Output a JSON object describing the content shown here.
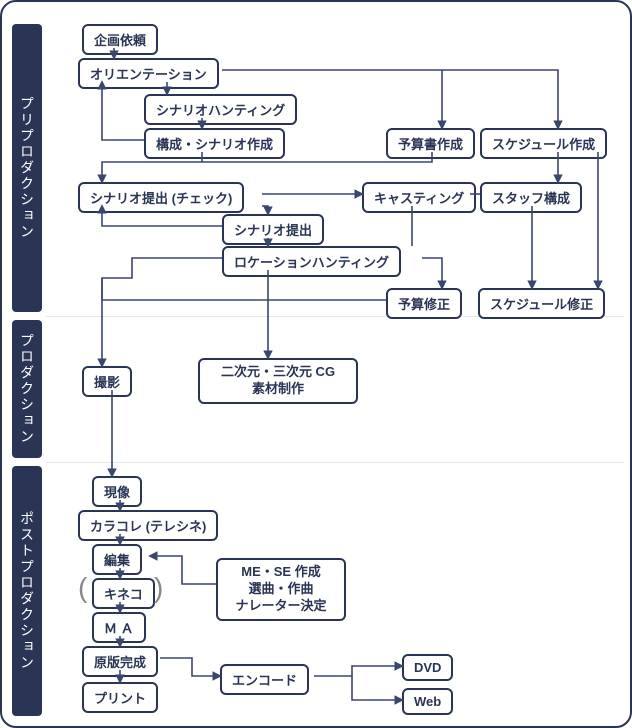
{
  "phases": {
    "pre": "プリプロダクション",
    "prod": "プロダクション",
    "post": "ポストプロダクション"
  },
  "nodes": {
    "n1": "企画依頼",
    "n2": "オリエンテーション",
    "n3": "シナリオハンティング",
    "n4": "構成・シナリオ作成",
    "n5": "予算書作成",
    "n6": "スケジュール作成",
    "n7": "シナリオ提出 (チェック)",
    "n8": "キャスティング",
    "n9": "スタッフ構成",
    "n10": "シナリオ提出",
    "n11": "ロケーションハンティング",
    "n12": "予算修正",
    "n13": "スケジュール修正",
    "n14": "撮影",
    "n15": "二次元・三次元 CG\n素材制作",
    "n16": "現像",
    "n17": "カラコレ (テレシネ)",
    "n18": "編集",
    "n19": "キネコ",
    "n20": "Ｍ Ａ",
    "n21": "ME・SE 作成\n選曲・作曲\nナレーター決定",
    "n22": "原版完成",
    "n23": "エンコード",
    "n24": "DVD",
    "n25": "Web",
    "n26": "プリント"
  }
}
